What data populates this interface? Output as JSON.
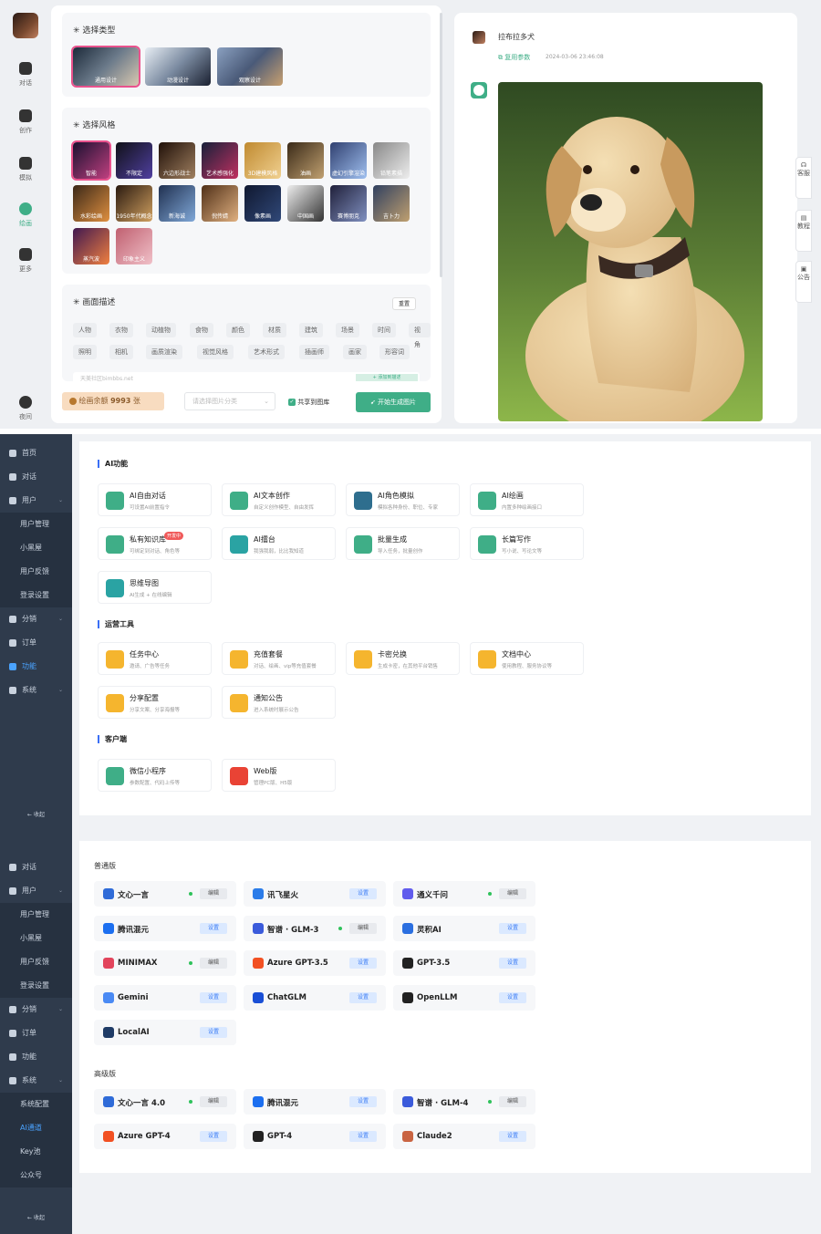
{
  "s1": {
    "nav": [
      {
        "label": "对话"
      },
      {
        "label": "创作"
      },
      {
        "label": "模拟"
      },
      {
        "label": "绘画"
      },
      {
        "label": "更多"
      },
      {
        "label": "夜间"
      }
    ],
    "type_title": "选择类型",
    "types": [
      {
        "label": "通用设计"
      },
      {
        "label": "动漫设计"
      },
      {
        "label": "观察设计"
      }
    ],
    "style_title": "选择风格",
    "styles": [
      {
        "label": "智能"
      },
      {
        "label": "不限定"
      },
      {
        "label": "六边形战士"
      },
      {
        "label": "艺术感强化"
      },
      {
        "label": "3D建模风格"
      },
      {
        "label": "油画"
      },
      {
        "label": "虚幻引擎渲染"
      },
      {
        "label": "铅笔素描"
      },
      {
        "label": "水彩绘画"
      },
      {
        "label": "1950年代概念"
      },
      {
        "label": "新海诚"
      },
      {
        "label": "倪传婧"
      },
      {
        "label": "像素画"
      },
      {
        "label": "中国画"
      },
      {
        "label": "赛博朋克"
      },
      {
        "label": "吉卜力"
      },
      {
        "label": "蒸汽波"
      },
      {
        "label": "印象主义"
      }
    ],
    "desc_title": "画面描述",
    "reset": "重置",
    "tags_row1": [
      "人物",
      "衣物",
      "动植物",
      "食物",
      "颜色",
      "材质",
      "建筑",
      "场景",
      "时间",
      "视角"
    ],
    "tags_row2": [
      "照明",
      "相机",
      "画质渲染",
      "视觉风格",
      "艺术形式",
      "插画师",
      "画家",
      "形容词"
    ],
    "prompt_placeholder": "天美社区bimbbs.net",
    "add_desc": "+ 添加到描述",
    "balance_label": "绘画余额",
    "balance_value": "9993",
    "balance_unit": "张",
    "category_placeholder": "请选择图片分类",
    "share_label": "共享到图库",
    "generate": "开始生成图片",
    "user_name": "拉布拉多犬",
    "reuse": "复用参数",
    "timestamp": "2024-03-06 23:46:08",
    "side_tabs": [
      "客服",
      "教程",
      "公告"
    ]
  },
  "s2": {
    "nav": [
      {
        "label": "首页"
      },
      {
        "label": "对话"
      },
      {
        "label": "用户"
      },
      {
        "label": "用户管理"
      },
      {
        "label": "小黑屋"
      },
      {
        "label": "用户反馈"
      },
      {
        "label": "登录设置"
      },
      {
        "label": "分销"
      },
      {
        "label": "订单"
      },
      {
        "label": "功能"
      },
      {
        "label": "系统"
      }
    ],
    "collapse": "收起",
    "sec_ai": "AI功能",
    "ai_cards": [
      {
        "t": "AI自由对话",
        "d": "可设置AI前置指令",
        "color": "#3fae87"
      },
      {
        "t": "AI文本创作",
        "d": "自定义创作模型、自由发挥",
        "color": "#3fae87"
      },
      {
        "t": "AI角色模拟",
        "d": "模拟各种身份、职位、专家",
        "color": "#2e6e8e"
      },
      {
        "t": "AI绘画",
        "d": "内置多种绘画接口",
        "color": "#3fae87"
      },
      {
        "t": "私有知识库",
        "d": "可绑定到对话、角色等",
        "color": "#3fae87",
        "badge": "开发中"
      },
      {
        "t": "AI擂台",
        "d": "我强我弱，比比我知道",
        "color": "#2aa3a3"
      },
      {
        "t": "批量生成",
        "d": "导入任务，批量创作",
        "color": "#3fae87"
      },
      {
        "t": "长篇写作",
        "d": "写小说、写论文等",
        "color": "#3fae87"
      },
      {
        "t": "思维导图",
        "d": "AI生成 + 在线编辑",
        "color": "#2aa3a3"
      }
    ],
    "sec_ops": "运营工具",
    "ops_cards": [
      {
        "t": "任务中心",
        "d": "邀请、广告等任务",
        "color": "#f5b52e"
      },
      {
        "t": "充值套餐",
        "d": "对话、绘画、vip等充值套餐",
        "color": "#f5b52e"
      },
      {
        "t": "卡密兑换",
        "d": "生成卡密，在其他平台销售",
        "color": "#f5b52e"
      },
      {
        "t": "文档中心",
        "d": "使用教程、服务协议等",
        "color": "#f5b52e"
      },
      {
        "t": "分享配置",
        "d": "分享文案、分享海报等",
        "color": "#f5b52e"
      },
      {
        "t": "通知公告",
        "d": "进入系统时展示公告",
        "color": "#f5b52e"
      }
    ],
    "sec_client": "客户端",
    "client_cards": [
      {
        "t": "微信小程序",
        "d": "参数配置、代码上传等",
        "color": "#3fae87"
      },
      {
        "t": "Web版",
        "d": "管理PC版、H5版",
        "color": "#e94335"
      }
    ]
  },
  "s3": {
    "nav": [
      {
        "label": "对话"
      },
      {
        "label": "用户"
      },
      {
        "label": "用户管理"
      },
      {
        "label": "小黑屋"
      },
      {
        "label": "用户反馈"
      },
      {
        "label": "登录设置"
      },
      {
        "label": "分销"
      },
      {
        "label": "订单"
      },
      {
        "label": "功能"
      },
      {
        "label": "系统"
      },
      {
        "label": "系统配置"
      },
      {
        "label": "AI通道"
      },
      {
        "label": "Key池"
      },
      {
        "label": "公众号"
      }
    ],
    "collapse": "收起",
    "group_normal": "普通版",
    "normal": [
      {
        "n": "文心一言",
        "b": "编辑",
        "on": true,
        "color": "#2f6bd8"
      },
      {
        "n": "讯飞星火",
        "b": "设置",
        "on": false,
        "color": "#2b7ce9"
      },
      {
        "n": "通义千问",
        "b": "编辑",
        "on": true,
        "color": "#615ced"
      },
      {
        "n": "腾讯混元",
        "b": "设置",
        "on": false,
        "color": "#1c6ff0"
      },
      {
        "n": "智谱 · GLM-3",
        "b": "编辑",
        "on": true,
        "color": "#3b5bdb"
      },
      {
        "n": "灵积AI",
        "b": "设置",
        "on": false,
        "color": "#2b6fe0"
      },
      {
        "n": "MINIMAX",
        "b": "编辑",
        "on": true,
        "color": "#e2445c"
      },
      {
        "n": "Azure GPT-3.5",
        "b": "设置",
        "on": false,
        "color": "#f25022"
      },
      {
        "n": "GPT-3.5",
        "b": "设置",
        "on": false,
        "color": "#222222"
      },
      {
        "n": "Gemini",
        "b": "设置",
        "on": false,
        "color": "#4a8af4"
      },
      {
        "n": "ChatGLM",
        "b": "设置",
        "on": false,
        "color": "#1a4fd6"
      },
      {
        "n": "OpenLLM",
        "b": "设置",
        "on": false,
        "color": "#222222"
      },
      {
        "n": "LocalAI",
        "b": "设置",
        "on": false,
        "color": "#1f3b66"
      }
    ],
    "group_adv": "高级版",
    "advanced": [
      {
        "n": "文心一言 4.0",
        "b": "编辑",
        "on": true,
        "color": "#2f6bd8"
      },
      {
        "n": "腾讯混元",
        "b": "设置",
        "on": false,
        "color": "#1c6ff0"
      },
      {
        "n": "智谱 · GLM-4",
        "b": "编辑",
        "on": true,
        "color": "#3b5bdb"
      },
      {
        "n": "Azure GPT-4",
        "b": "设置",
        "on": false,
        "color": "#f25022"
      },
      {
        "n": "GPT-4",
        "b": "设置",
        "on": false,
        "color": "#222222"
      },
      {
        "n": "Claude2",
        "b": "设置",
        "on": false,
        "color": "#c96442"
      }
    ]
  }
}
